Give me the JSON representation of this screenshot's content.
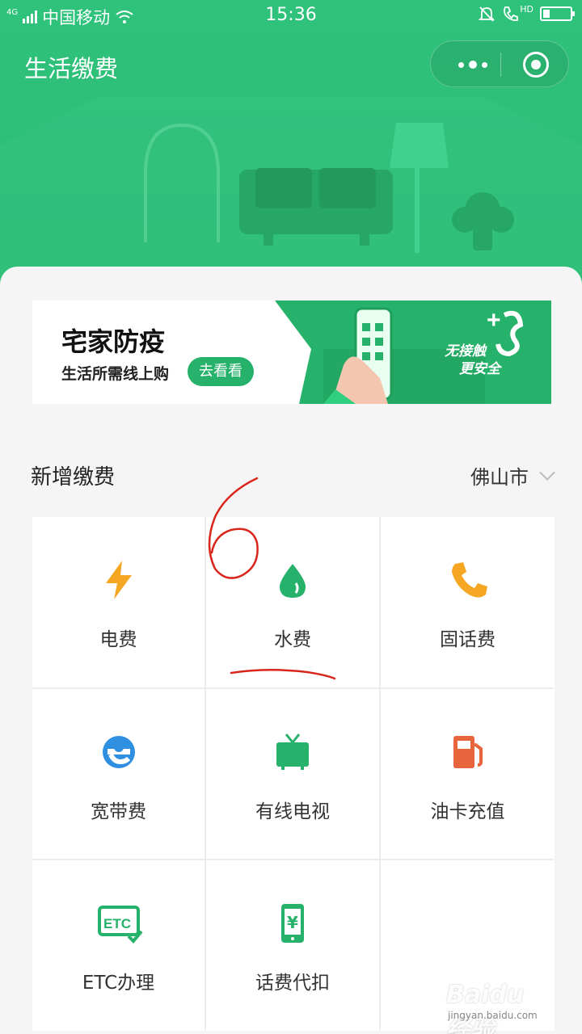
{
  "status_bar": {
    "network": "4G",
    "carrier": "中国移动",
    "time": "15:36",
    "hd": "HD"
  },
  "nav": {
    "title": "生活缴费",
    "more_icon": "more-dots-icon",
    "close_icon": "target-circle-icon"
  },
  "banner": {
    "title": "宅家防疫",
    "subtitle": "生活所需线上购",
    "button": "去看看",
    "tag_line1": "无接触",
    "tag_line2": "更安全"
  },
  "section": {
    "title": "新增缴费",
    "city": "佛山市"
  },
  "services": [
    {
      "label": "电费",
      "icon": "lightning-icon",
      "color": "#f5a623"
    },
    {
      "label": "水费",
      "icon": "water-drop-icon",
      "color": "#26b26a"
    },
    {
      "label": "固话费",
      "icon": "phone-icon",
      "color": "#f5a623"
    },
    {
      "label": "宽带费",
      "icon": "ie-e-icon",
      "color": "#2f8fe0"
    },
    {
      "label": "有线电视",
      "icon": "tv-icon",
      "color": "#26b26a"
    },
    {
      "label": "油卡充值",
      "icon": "fuel-pump-icon",
      "color": "#e8643c"
    },
    {
      "label": "ETC办理",
      "icon": "etc-icon",
      "color": "#26b26a"
    },
    {
      "label": "话费代扣",
      "icon": "mobile-yuan-icon",
      "color": "#26b26a"
    }
  ],
  "annotation": {
    "number": "6",
    "color": "#d9261c"
  },
  "watermark": {
    "main": "Baidu 经验",
    "sub": "jingyan.baidu.com"
  }
}
